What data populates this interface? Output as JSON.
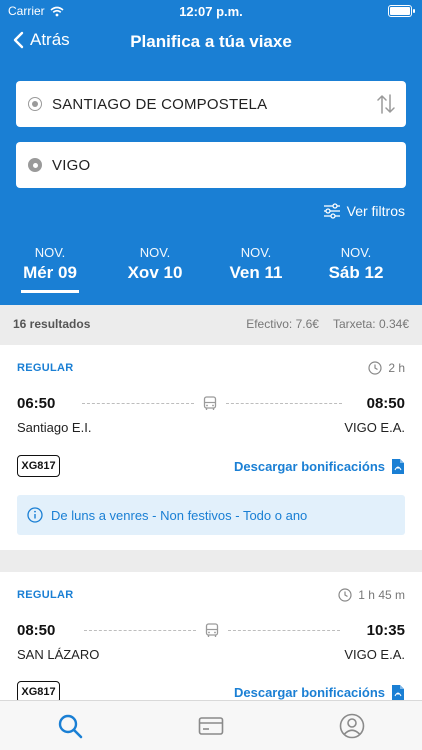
{
  "status_bar": {
    "carrier": "Carrier",
    "time": "12:07 p.m."
  },
  "nav": {
    "back_label": "Atrás",
    "title": "Planifica a túa viaxe"
  },
  "search": {
    "origin": "SANTIAGO DE COMPOSTELA",
    "destination": "VIGO",
    "filters_label": "Ver filtros"
  },
  "dates": [
    {
      "month": "NOV.",
      "day": "Mér 09",
      "selected": true
    },
    {
      "month": "NOV.",
      "day": "Xov 10",
      "selected": false
    },
    {
      "month": "NOV.",
      "day": "Ven 11",
      "selected": false
    },
    {
      "month": "NOV.",
      "day": "Sáb 12",
      "selected": false
    }
  ],
  "summary": {
    "count": "16 resultados",
    "cash": "Efectivo: 7.6€",
    "card": "Tarxeta: 0.34€"
  },
  "results": [
    {
      "type": "REGULAR",
      "duration": "2 h",
      "departure": "06:50",
      "arrival": "08:50",
      "origin": "Santiago E.I.",
      "destination": "VIGO E.A.",
      "code": "XG817",
      "discount_label": "Descargar bonificacións",
      "note": "De luns a venres - Non festivos - Todo o ano"
    },
    {
      "type": "REGULAR",
      "duration": "1 h 45 m",
      "departure": "08:50",
      "arrival": "10:35",
      "origin": "SAN LÁZARO",
      "destination": "VIGO E.A.",
      "code": "XG817",
      "discount_label": "Descargar bonificacións"
    }
  ],
  "tabs": [
    {
      "icon": "search-icon",
      "active": true
    },
    {
      "icon": "card-icon",
      "active": false
    },
    {
      "icon": "user-icon",
      "active": false
    }
  ],
  "colors": {
    "primary": "#1a7fd4",
    "background": "#ececec",
    "note_bg": "#e2f0fb"
  }
}
